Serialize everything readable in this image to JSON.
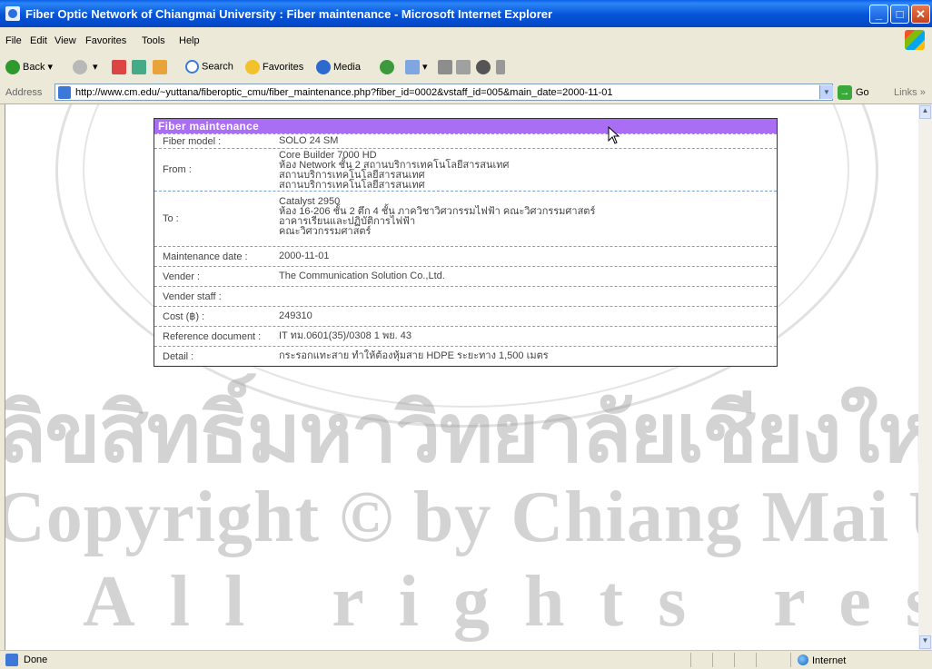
{
  "window": {
    "title": "Fiber Optic Network of Chiangmai University : Fiber maintenance - Microsoft Internet Explorer",
    "minimize": "_",
    "maximize": "□",
    "close": "✕"
  },
  "menu": [
    "File",
    "Edit",
    "View",
    "Favorites",
    "Tools",
    "Help"
  ],
  "toolbar": {
    "back": "Back",
    "search": "Search",
    "favorites": "Favorites",
    "media": "Media"
  },
  "address": {
    "label": "Address",
    "url": "http://www.cm.edu/~yuttana/fiberoptic_cmu/fiber_maintenance.php?fiber_id=0002&vstaff_id=005&main_date=2000-11-01",
    "go": "Go",
    "links": "Links"
  },
  "panel": {
    "heading": "Fiber maintenance",
    "rows": [
      {
        "label": "Fiber model :",
        "lines": [
          "SOLO 24 SM"
        ]
      },
      {
        "label": "From :",
        "lines": [
          "Core Builder 7000 HD",
          "ห้อง Network ชั้น 2 สถานบริการเทคโนโลยีสารสนเทศ",
          "สถานบริการเทคโนโลยีสารสนเทศ",
          "สถานบริการเทคโนโลยีสารสนเทศ"
        ]
      },
      {
        "label": "To :",
        "lines": [
          "Catalyst 2950",
          "ห้อง 16-206 ชั้น 2 ตึก 4 ชั้น ภาควิชาวิศวกรรมไฟฟ้า คณะวิศวกรรมศาสตร์",
          "อาคารเรียนและปฏิบัติการไฟฟ้า",
          "คณะวิศวกรรมศาสตร์"
        ]
      },
      {
        "label": "Maintenance date :",
        "lines": [
          "2000-11-01"
        ]
      },
      {
        "label": "Vender :",
        "lines": [
          "The Communication Solution Co.,Ltd."
        ]
      },
      {
        "label": "Vender staff :",
        "lines": [
          ""
        ]
      },
      {
        "label": "Cost (฿) :",
        "lines": [
          "249310"
        ]
      },
      {
        "label": "Reference document :",
        "lines": [
          "IT ทม.0601(35)/0308 1 พย. 43"
        ]
      },
      {
        "label": "Detail :",
        "lines": [
          "กระรอกแทะสาย ทำให้ต้องหุ้มสาย HDPE ระยะทาง 1,500 เมตร"
        ]
      }
    ]
  },
  "watermark": {
    "line1": "ลิขสิทธิ์มหาวิทยาลัยเชียงใหม่",
    "line2": "Copyright © by Chiang Mai University",
    "line3": "All rights reserved"
  },
  "status": {
    "text": "Done",
    "zone": "Internet"
  }
}
